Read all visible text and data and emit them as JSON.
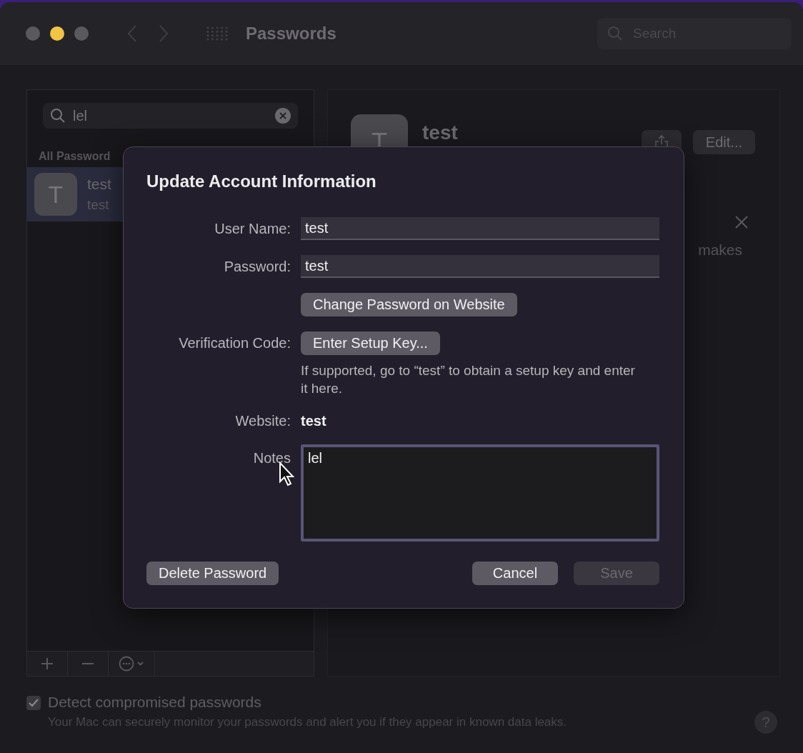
{
  "window": {
    "title": "Passwords",
    "search": {
      "placeholder": "Search"
    }
  },
  "sidebar": {
    "search": {
      "value": "lel"
    },
    "section": "All Password",
    "items": [
      {
        "initial": "T",
        "title": "test",
        "subtitle": "test",
        "selected": true
      }
    ]
  },
  "detail": {
    "initial": "T",
    "title": "test",
    "edit_button": "Edit...",
    "notice_fragment": "makes"
  },
  "dialog": {
    "title": "Update Account Information",
    "fields": [
      {
        "kind": "input",
        "label": "User Name:",
        "value": "test"
      },
      {
        "kind": "input",
        "label": "Password:",
        "value": "test"
      },
      {
        "kind": "button",
        "button": "Change Password on Website"
      },
      {
        "kind": "button",
        "label": "Verification Code:",
        "button": "Enter Setup Key...",
        "hint": "If supported, go to “test” to obtain a setup key and enter it here."
      },
      {
        "kind": "text",
        "label": "Website:",
        "value": "test"
      },
      {
        "kind": "notes",
        "label": "Notes",
        "value": "lel"
      }
    ],
    "buttons": [
      {
        "label": "Delete Password",
        "disabled": false
      },
      {
        "label": "Cancel",
        "disabled": false
      },
      {
        "label": "Save",
        "disabled": true
      }
    ]
  },
  "footer": {
    "checkbox": {
      "label": "Detect compromised passwords",
      "checked": true
    },
    "description": "Your Mac can securely monitor your passwords and alert you if they appear in known data leaks.",
    "help": "?"
  }
}
